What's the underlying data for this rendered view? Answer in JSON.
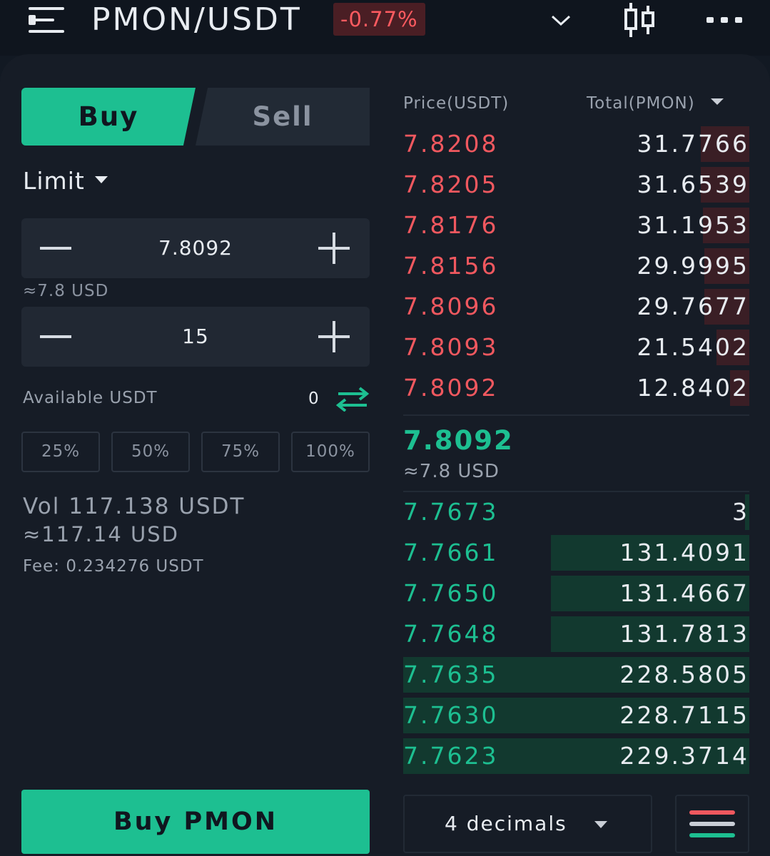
{
  "header": {
    "pair": "PMON/USDT",
    "change": "-0.77%",
    "icons": {
      "menu": "menu-icon",
      "dropdown": "chevron-down-icon",
      "chart": "candlestick-icon",
      "more": "more-icon"
    }
  },
  "order_form": {
    "tabs": {
      "buy": "Buy",
      "sell": "Sell"
    },
    "order_type": "Limit",
    "price_value": "7.8092",
    "price_approx": "≈7.8 USD",
    "amount_value": "15",
    "available_label": "Available USDT",
    "available_value": "0",
    "percent_buttons": [
      "25%",
      "50%",
      "75%",
      "100%"
    ],
    "volume": "Vol 117.138 USDT",
    "volume_usd": "≈117.14 USD",
    "fee": "Fee:  0.234276 USDT",
    "submit_label": "Buy PMON"
  },
  "orderbook": {
    "price_header": "Price(USDT)",
    "total_header": "Total(PMON)",
    "asks": [
      {
        "price": "7.8208",
        "total": "31.7766",
        "depth": 0.14
      },
      {
        "price": "7.8205",
        "total": "31.6539",
        "depth": 0.14
      },
      {
        "price": "7.8176",
        "total": "31.1953",
        "depth": 0.135
      },
      {
        "price": "7.8156",
        "total": "29.9995",
        "depth": 0.13
      },
      {
        "price": "7.8096",
        "total": "29.7677",
        "depth": 0.13
      },
      {
        "price": "7.8093",
        "total": "21.5402",
        "depth": 0.094
      },
      {
        "price": "7.8092",
        "total": "12.8402",
        "depth": 0.056
      }
    ],
    "mid_price": "7.8092",
    "mid_usd": "≈7.8 USD",
    "bids": [
      {
        "price": "7.7673",
        "total": "3",
        "depth": 0.013
      },
      {
        "price": "7.7661",
        "total": "131.4091",
        "depth": 0.573
      },
      {
        "price": "7.7650",
        "total": "131.4667",
        "depth": 0.573
      },
      {
        "price": "7.7648",
        "total": "131.7813",
        "depth": 0.574
      },
      {
        "price": "7.7635",
        "total": "228.5805",
        "depth": 1.0
      },
      {
        "price": "7.7630",
        "total": "228.7115",
        "depth": 1.0
      },
      {
        "price": "7.7623",
        "total": "229.3714",
        "depth": 1.0
      }
    ],
    "decimals_label": "4 decimals"
  },
  "colors": {
    "buy": "#1dbf91",
    "sell": "#f0585f",
    "background": "#121923"
  }
}
